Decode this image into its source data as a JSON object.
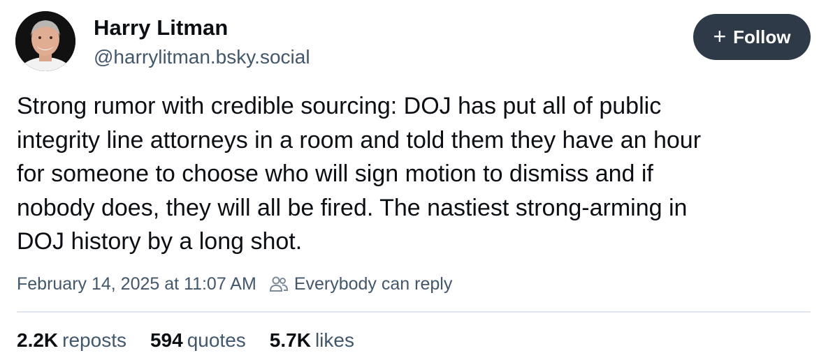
{
  "author": {
    "display_name": "Harry Litman",
    "handle": "@harrylitman.bsky.social",
    "avatar_icon": "person-portrait-avatar"
  },
  "follow_button": {
    "icon": "plus-icon",
    "label": "Follow"
  },
  "post": {
    "text": "Strong rumor with credible sourcing: DOJ has put all of public\nintegrity line attorneys in a room and told them they have an hour\nfor someone to choose who will sign motion to dismiss and if\nnobody does, they will all be fired. The nastiest strong-arming in\nDOJ history by a long shot."
  },
  "meta": {
    "timestamp": "February 14, 2025 at 11:07 AM",
    "reply_icon": "people-icon",
    "reply_setting": "Everybody can reply"
  },
  "stats": [
    {
      "count": "2.2K",
      "label": "reposts"
    },
    {
      "count": "594",
      "label": "quotes"
    },
    {
      "count": "5.7K",
      "label": "likes"
    }
  ],
  "colors": {
    "text_primary": "#0b0f14",
    "text_secondary": "#42576c",
    "follow_button_bg": "#2e3a48",
    "divider": "#dfe4ea"
  }
}
